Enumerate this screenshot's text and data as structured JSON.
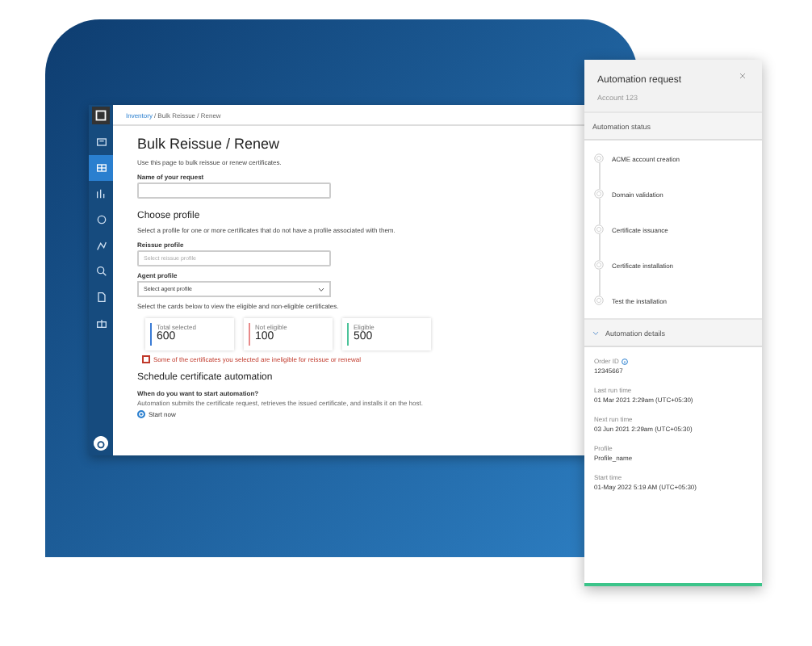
{
  "app": {
    "breadcrumb": {
      "link": "Inventory",
      "rest": "/ Bulk Reissue / Renew"
    },
    "sidebar": {
      "items": [
        {
          "selected": false
        },
        {
          "selected": true
        },
        {
          "selected": false
        },
        {
          "selected": false
        },
        {
          "selected": false
        },
        {
          "selected": false
        },
        {
          "selected": false
        },
        {
          "selected": false
        }
      ]
    },
    "title": "Bulk Reissue / Renew",
    "description": "Use this page to bulk reissue or renew certificates.",
    "name_field": {
      "label": "Name of your request"
    },
    "profile_section": {
      "heading": "Choose profile",
      "description": "Select a profile for one or more certificates that do not have a profile associated with them.",
      "reissue_profile": {
        "label": "Reissue profile",
        "placeholder": "Select reissue profile"
      },
      "agent_profile": {
        "label": "Agent profile",
        "value": "Select agent profile"
      }
    },
    "cards_intro": "Select the cards below to view the eligible and non-eligible certificates.",
    "cards": [
      {
        "label": "Total selected",
        "value": "600",
        "color": "#3a7bd5"
      },
      {
        "label": "Not eligible",
        "value": "100",
        "color": "#e88a8a"
      },
      {
        "label": "Eligible",
        "value": "500",
        "color": "#4cc39a"
      }
    ],
    "warning": {
      "checked": false,
      "text": "Some of the certificates you selected are ineligible for reissue or renewal"
    },
    "schedule": {
      "heading": "Schedule certificate automation",
      "question": "When do you want to start automation?",
      "hint": "Automation submits the certificate request, retrieves the issued certificate, and installs it on the host.",
      "options": [
        {
          "label": "Start now",
          "selected": true
        }
      ]
    }
  },
  "panel": {
    "title": "Automation request",
    "subtitle": "Account 123",
    "status_heading": "Automation status",
    "steps": [
      "ACME account creation",
      "Domain validation",
      "Certificate issuance",
      "Certificate installation",
      "Test the installation"
    ],
    "details_heading": "Automation details",
    "details_expanded": true,
    "details": [
      {
        "label": "Order ID",
        "value": "12345667",
        "info": true
      },
      {
        "label": "Last run time",
        "value": "01 Mar 2021 2:29am (UTC+05:30)",
        "info": false
      },
      {
        "label": "Next run time",
        "value": "03 Jun 2021 2:29am (UTC+05:30)",
        "info": false
      },
      {
        "label": "Profile",
        "value": "Profile_name",
        "info": false
      },
      {
        "label": "Start time",
        "value": "01-May 2022 5:19 AM (UTC+05:30)",
        "info": false
      }
    ]
  }
}
